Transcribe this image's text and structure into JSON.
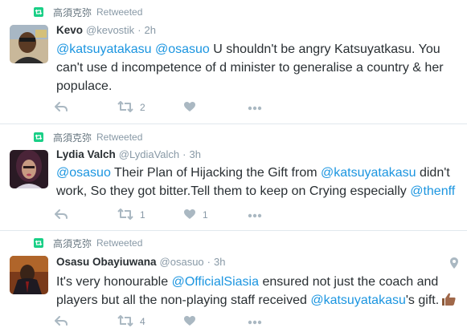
{
  "tweets": [
    {
      "retweeter": "高須克弥",
      "retweeted_label": "Retweeted",
      "fullname": "Kevo",
      "username": "@kevostik",
      "dot": "·",
      "time": "2h",
      "text_parts": [
        {
          "t": "@katsuyatakasu",
          "m": true
        },
        {
          "t": " ",
          "m": false
        },
        {
          "t": "@osasuo",
          "m": true
        },
        {
          "t": " U shouldn't be angry Katsuyatkasu. You can't use d incompetence of d minister to generalise a country & her populace.",
          "m": false
        }
      ],
      "retweet_count": "2",
      "like_count": ""
    },
    {
      "retweeter": "高須克弥",
      "retweeted_label": "Retweeted",
      "fullname": "Lydia Valch",
      "username": "@LydiaValch",
      "dot": "·",
      "time": "3h",
      "text_parts": [
        {
          "t": "@osasuo",
          "m": true
        },
        {
          "t": " Their Plan of Hijacking the Gift from ",
          "m": false
        },
        {
          "t": "@katsuyatakasu",
          "m": true
        },
        {
          "t": " didn't work, So they got bitter.Tell them to keep on Crying especially ",
          "m": false
        },
        {
          "t": "@thenff",
          "m": true
        }
      ],
      "retweet_count": "1",
      "like_count": "1"
    },
    {
      "retweeter": "高須克弥",
      "retweeted_label": "Retweeted",
      "fullname": "Osasu Obayiuwana",
      "username": "@osasuo",
      "dot": "·",
      "time": "3h",
      "text_parts": [
        {
          "t": "It's very honourable ",
          "m": false
        },
        {
          "t": "@OfficialSiasia",
          "m": true
        },
        {
          "t": " ensured not just the coach and players but all the non-playing staff received ",
          "m": false
        },
        {
          "t": "@katsuyatakasu",
          "m": true
        },
        {
          "t": "'s gift.",
          "m": false
        }
      ],
      "retweet_count": "4",
      "like_count": ""
    }
  ],
  "colors": {
    "retweet_green": "#19cf86",
    "mention_blue": "#1b95e0",
    "action_gray": "#aab8c2"
  },
  "icons": {
    "retweeted": "retweet-icon",
    "reply": "reply-icon",
    "retweet": "retweet-icon",
    "like": "heart-icon",
    "more": "more-icon",
    "location": "location-pin-icon",
    "emoji": "thumbs-up-emoji"
  }
}
